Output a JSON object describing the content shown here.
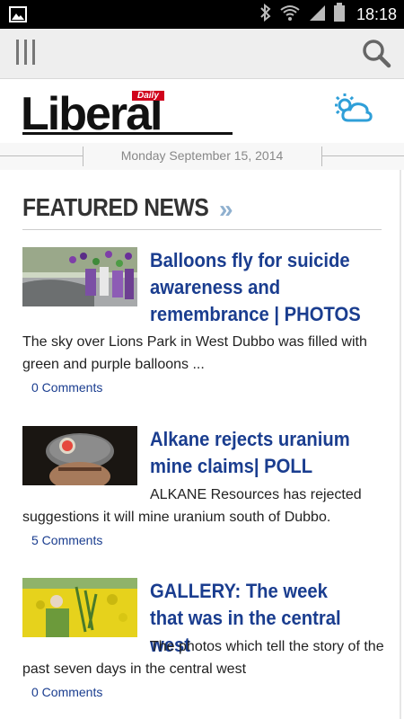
{
  "status_bar": {
    "time": "18:18",
    "icons": [
      "picture-icon",
      "bluetooth-icon",
      "wifi-icon",
      "signal-icon",
      "battery-icon"
    ]
  },
  "app_bar": {
    "icons": [
      "menu-icon",
      "search-icon"
    ]
  },
  "header": {
    "logo_daily": "Daily",
    "logo_name": "Liberal",
    "weather_icon": "partly-cloudy-icon",
    "brand_color": "#d0021b"
  },
  "date": "Monday September 15, 2014",
  "section": {
    "title": "FEATURED NEWS",
    "chevron": "»",
    "accent": "#8fb0cf"
  },
  "articles": [
    {
      "headline": "Balloons fly for suicide awareness and remembrance | PHOTOS",
      "summary": "The sky over Lions Park in West Dubbo was filled with green and purple balloons ...",
      "comments": "0 Comments"
    },
    {
      "headline": "Alkane rejects uranium mine claims| POLL",
      "summary": "ALKANE Resources has rejected suggestions it will mine uranium south of Dubbo.",
      "comments": "5 Comments"
    },
    {
      "headline": "GALLERY: The week that was in the central west",
      "summary": "The photos which tell the story of the past seven days in the central west",
      "comments": "0 Comments"
    }
  ],
  "colors": {
    "headline": "#1a3d8f",
    "link": "#1a3d8f"
  }
}
